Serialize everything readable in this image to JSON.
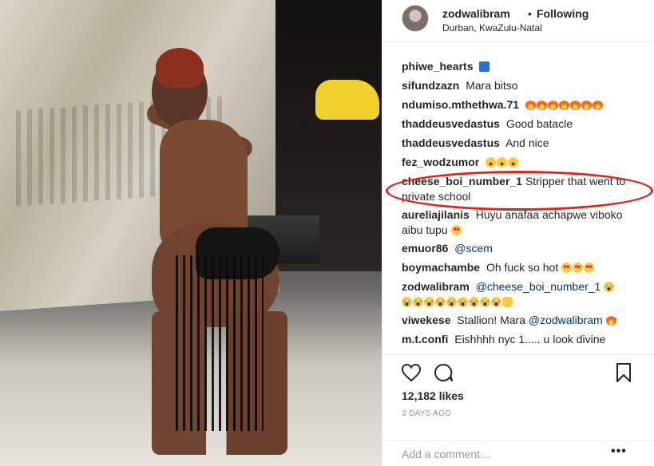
{
  "post": {
    "username": "zodwalibram",
    "separator": "•",
    "follow_status": "Following",
    "location": "Durban, KwaZulu-Natal"
  },
  "comments": [
    {
      "user": "phiwe_hearts",
      "text": "",
      "emoji": [
        "wheelchair"
      ]
    },
    {
      "user": "sifundzazn",
      "text": "Mara bitso"
    },
    {
      "user": "ndumiso.mthethwa.71",
      "text": "",
      "emoji": [
        "fire",
        "fire",
        "fire",
        "fire",
        "fire",
        "fire",
        "fire"
      ]
    },
    {
      "user": "thaddeusvedastus",
      "text": "Good batacle"
    },
    {
      "user": "thaddeusvedastus",
      "text": "And nice"
    },
    {
      "user": "fez_wodzumor",
      "text": "",
      "emoji": [
        "open-mouth",
        "open-mouth",
        "open-mouth"
      ]
    },
    {
      "user": "cheese_boi_number_1",
      "text": "Stripper that went to private school"
    },
    {
      "user": "aureliajilanis",
      "text": "Huyu anafaa achapwe viboko aibu tupu",
      "emoji": [
        "heart-eyes"
      ]
    },
    {
      "user": "emuor86",
      "text": "",
      "mention": "@scem"
    },
    {
      "user": "boymachambe",
      "text": "Oh fuck so hot",
      "emoji": [
        "heart-eyes",
        "heart-eyes",
        "heart-eyes"
      ]
    },
    {
      "user": "zodwalibram",
      "text": "",
      "mention": "@cheese_boi_number_1",
      "emoji": [
        "joy",
        "joy",
        "joy",
        "joy",
        "joy",
        "joy",
        "joy",
        "joy",
        "joy",
        "joy",
        "clap"
      ]
    },
    {
      "user": "viwekese",
      "text": "Stallion! Mara",
      "mention": "@zodwalibram",
      "emoji": [
        "fire"
      ]
    },
    {
      "user": "m.t.confi",
      "text": "Eishhhh nyc 1..... u look divine"
    }
  ],
  "actions": {
    "likes": "12,182 likes",
    "date": "3 DAYS AGO"
  },
  "add_comment": {
    "placeholder": "Add a comment…",
    "more": "•••"
  },
  "colors": {
    "highlight": "#e2231a",
    "mention": "#003569",
    "muted": "#999999"
  }
}
